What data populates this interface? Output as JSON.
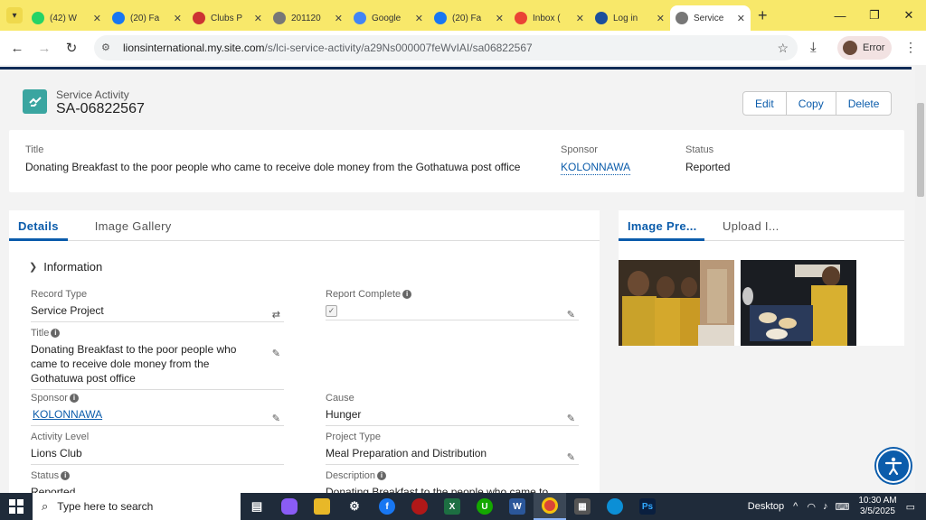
{
  "browser": {
    "tabs": [
      {
        "title": "(42) W",
        "icon": "whatsapp-icon",
        "color": "#25d366"
      },
      {
        "title": "(20) Fa",
        "icon": "facebook-icon",
        "color": "#1877f2"
      },
      {
        "title": "Clubs P",
        "icon": "lions-icon",
        "color": "#c33"
      },
      {
        "title": "201120",
        "icon": "globe-icon",
        "color": "#777"
      },
      {
        "title": "Google",
        "icon": "google-translate-icon",
        "color": "#4285f4"
      },
      {
        "title": "(20) Fa",
        "icon": "facebook-icon",
        "color": "#1877f2"
      },
      {
        "title": "Inbox (",
        "icon": "gmail-icon",
        "color": "#ea4335"
      },
      {
        "title": "Log in",
        "icon": "lions-icon",
        "color": "#1b4f9c"
      },
      {
        "title": "Service",
        "icon": "globe-icon",
        "color": "#777",
        "active": true
      }
    ],
    "url_host": "lionsinternational.my.site.com",
    "url_path": "/s/lci-service-activity/a29Ns000007feWvIAI/sa06822567",
    "profile_label": "Error"
  },
  "record": {
    "type_label": "Service Activity",
    "name": "SA-06822567",
    "buttons": {
      "edit": "Edit",
      "copy": "Copy",
      "delete": "Delete"
    }
  },
  "highlights": {
    "title_label": "Title",
    "title_value": "Donating Breakfast to the poor people who came to receive dole money from the Gothatuwa post office",
    "sponsor_label": "Sponsor",
    "sponsor_value": "KOLONNAWA",
    "status_label": "Status",
    "status_value": "Reported"
  },
  "details": {
    "tabs": [
      "Details",
      "Image Gallery"
    ],
    "section": "Information",
    "fields": {
      "record_type": {
        "label": "Record Type",
        "value": "Service Project"
      },
      "report_complete": {
        "label": "Report Complete"
      },
      "title": {
        "label": "Title",
        "value": "Donating Breakfast to the poor people who came to receive dole money from the Gothatuwa post office"
      },
      "sponsor": {
        "label": "Sponsor",
        "value": "KOLONNAWA"
      },
      "cause": {
        "label": "Cause",
        "value": "Hunger"
      },
      "activity_level": {
        "label": "Activity Level",
        "value": "Lions Club"
      },
      "project_type": {
        "label": "Project Type",
        "value": "Meal Preparation and Distribution"
      },
      "status": {
        "label": "Status",
        "value": "Reported"
      },
      "description": {
        "label": "Description",
        "value": "Donating Breakfast to the people who came to"
      }
    }
  },
  "images": {
    "tabs": [
      "Image Pre...",
      "Upload I..."
    ]
  },
  "taskbar": {
    "search_placeholder": "Type here to search",
    "desktop_label": "Desktop",
    "time": "10:30 AM",
    "date": "3/5/2025"
  }
}
